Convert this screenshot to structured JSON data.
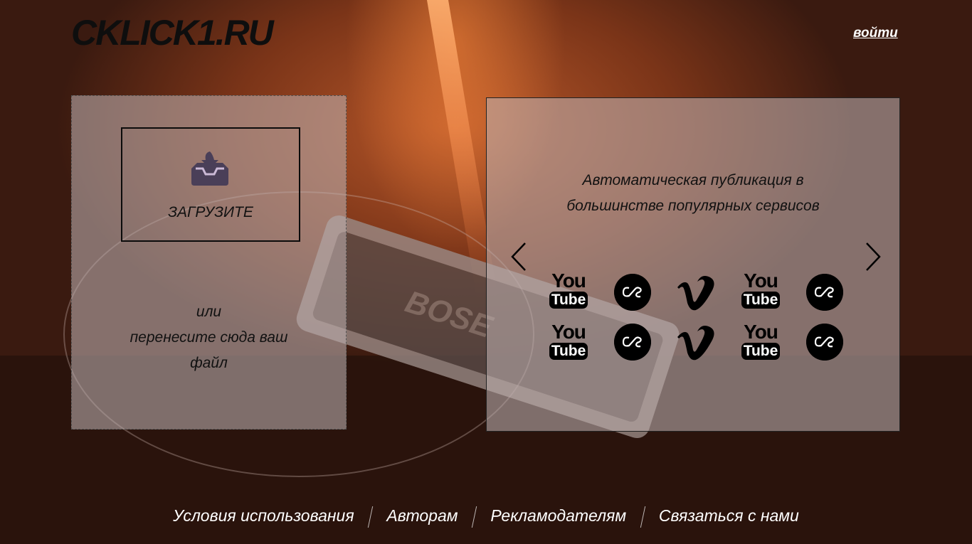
{
  "header": {
    "logo": "CKLICK1.RU",
    "login_label": "войти"
  },
  "upload": {
    "button_label": "ЗАГРУЗИТЕ",
    "or_text": "или",
    "drop_line1": "перенесите сюда ваш",
    "drop_line2": "файл"
  },
  "services": {
    "title_line1": "Автоматическая публикация в",
    "title_line2": "большинстве популярных сервисов",
    "icons": [
      "youtube-icon",
      "lastfm-icon",
      "vimeo-icon",
      "youtube-icon",
      "lastfm-icon",
      "youtube-icon",
      "lastfm-icon",
      "vimeo-icon",
      "youtube-icon",
      "lastfm-icon"
    ],
    "youtube_you": "You",
    "youtube_tube": "Tube"
  },
  "footer": {
    "links": [
      "Условия использования",
      "Авторам",
      "Рекламодателям",
      "Связаться с нами"
    ]
  },
  "colors": {
    "panel": "#beafaf",
    "text": "#111111",
    "accent_bg": "#7a3418"
  }
}
